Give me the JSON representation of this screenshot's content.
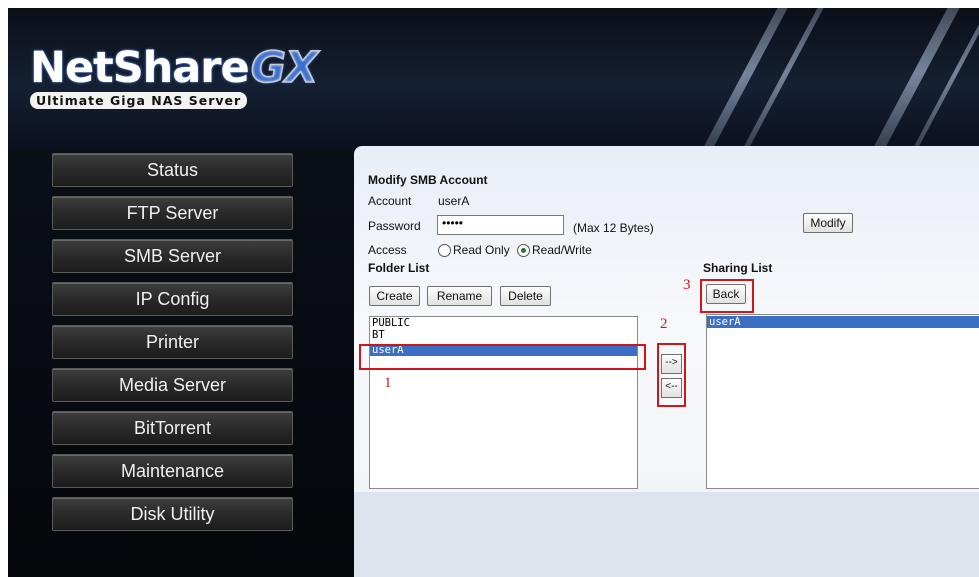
{
  "brand": {
    "logo_main": "NetShare",
    "logo_accent": "GX",
    "logo_sub": "Ultimate Giga NAS Server"
  },
  "menu": [
    {
      "label": "Status"
    },
    {
      "label": "FTP Server"
    },
    {
      "label": "SMB Server"
    },
    {
      "label": "IP Config"
    },
    {
      "label": "Printer"
    },
    {
      "label": "Media Server"
    },
    {
      "label": "BitTorrent"
    },
    {
      "label": "Maintenance"
    },
    {
      "label": "Disk Utility"
    }
  ],
  "form": {
    "title": "Modify SMB Account",
    "account_label": "Account",
    "account_value": "userA",
    "password_label": "Password",
    "password_value": "•••••",
    "password_hint": "(Max 12 Bytes)",
    "access_label": "Access",
    "read_only": "Read Only",
    "read_write": "Read/Write",
    "access_selected": "Read/Write",
    "modify_button": "Modify"
  },
  "folder_list": {
    "title": "Folder List",
    "create": "Create",
    "rename": "Rename",
    "delete": "Delete",
    "items": [
      "PUBLIC",
      "BT",
      "userA"
    ],
    "selected": "userA"
  },
  "transfer": {
    "add": "-->",
    "remove": "<--"
  },
  "sharing_list": {
    "title": "Sharing List",
    "back": "Back",
    "items": [
      "userA"
    ],
    "selected": "userA"
  },
  "annotations": {
    "step1": "1",
    "step2": "2",
    "step3": "3"
  },
  "colors": {
    "annotation_red": "#d2141b",
    "selection_blue": "#3b6fc4"
  }
}
